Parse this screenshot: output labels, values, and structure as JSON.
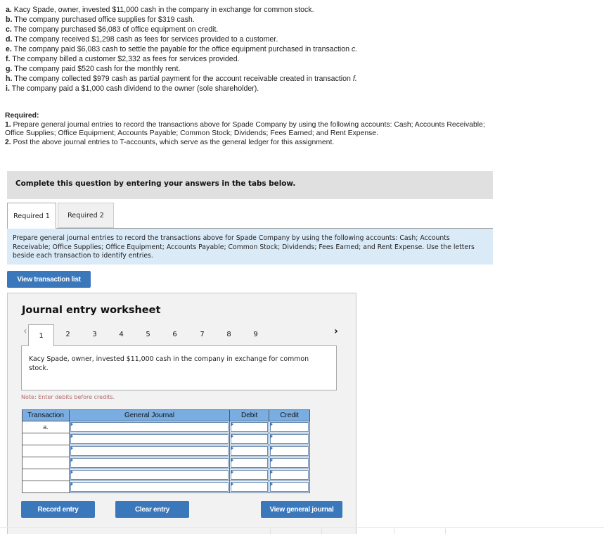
{
  "transactions": [
    {
      "letter": "a.",
      "text": "Kacy Spade, owner, invested $11,000 cash in the company in exchange for common stock."
    },
    {
      "letter": "b.",
      "text": "The company purchased office supplies for $319 cash."
    },
    {
      "letter": "c.",
      "text": "The company purchased $6,083 of office equipment on credit."
    },
    {
      "letter": "d.",
      "text": "The company received $1,298 cash as fees for services provided to a customer."
    },
    {
      "letter": "e.",
      "text": "The company paid $6,083 cash to settle the payable for the office equipment purchased in transaction ",
      "ref": "c."
    },
    {
      "letter": "f.",
      "text": "The company billed a customer $2,332 as fees for services provided."
    },
    {
      "letter": "g.",
      "text": "The company paid $520 cash for the monthly rent."
    },
    {
      "letter": "h.",
      "text": "The company collected $979 cash as partial payment for the account receivable created in transaction ",
      "ref": "f."
    },
    {
      "letter": "i.",
      "text": "The company paid a $1,000 cash dividend to the owner (sole shareholder)."
    }
  ],
  "required": {
    "heading": "Required:",
    "items": [
      {
        "num": "1.",
        "text": " Prepare general journal entries to record the transactions above for Spade Company by using the following accounts: Cash; Accounts Receivable; Office Supplies; Office Equipment; Accounts Payable; Common Stock; Dividends; Fees Earned; and Rent Expense."
      },
      {
        "num": "2.",
        "text": " Post the above journal entries to T-accounts, which serve as the general ledger for this assignment."
      }
    ]
  },
  "banner": "Complete this question by entering your answers in the tabs below.",
  "tabs": [
    {
      "label": "Required 1",
      "active": true
    },
    {
      "label": "Required 2",
      "active": false
    }
  ],
  "instructions": "Prepare general journal entries to record the transactions above for Spade Company by using the following accounts: Cash; Accounts Receivable; Office Supplies; Office Equipment; Accounts Payable; Common Stock; Dividends; Fees Earned; and Rent Expense. Use the letters beside each transaction to identify entries.",
  "buttons": {
    "view_transaction_list": "View transaction list",
    "record_entry": "Record entry",
    "clear_entry": "Clear entry",
    "view_general_journal": "View general journal"
  },
  "worksheet": {
    "title": "Journal entry worksheet",
    "prev_icon": "‹",
    "next_icon": "›",
    "pages": [
      "1",
      "2",
      "3",
      "4",
      "5",
      "6",
      "7",
      "8",
      "9"
    ],
    "active_page": "1",
    "description": "Kacy Spade, owner, invested $11,000 cash in the company in exchange for common stock.",
    "note": "Note: Enter debits before credits.",
    "table": {
      "headers": [
        "Transaction",
        "General Journal",
        "Debit",
        "Credit"
      ],
      "rows": [
        {
          "transaction": "a.",
          "general_journal": "",
          "debit": "",
          "credit": ""
        },
        {
          "transaction": "",
          "general_journal": "",
          "debit": "",
          "credit": ""
        },
        {
          "transaction": "",
          "general_journal": "",
          "debit": "",
          "credit": ""
        },
        {
          "transaction": "",
          "general_journal": "",
          "debit": "",
          "credit": ""
        },
        {
          "transaction": "",
          "general_journal": "",
          "debit": "",
          "credit": ""
        },
        {
          "transaction": "",
          "general_journal": "",
          "debit": "",
          "credit": ""
        }
      ]
    }
  },
  "colors": {
    "button_blue": "#3a77bb",
    "table_header_blue": "#7aaee3",
    "instructions_bg": "#dbeaf7",
    "banner_bg": "#e0e0e0",
    "worksheet_bg": "#f2f2f2",
    "note_text": "#b06a6a"
  }
}
